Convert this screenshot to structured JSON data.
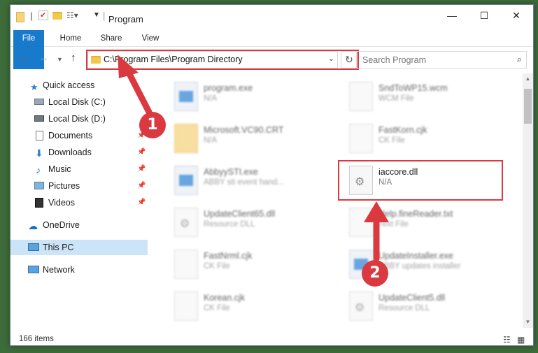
{
  "window": {
    "title": "Program"
  },
  "ribbon": {
    "tabs": [
      "File",
      "Home",
      "Share",
      "View"
    ]
  },
  "address": {
    "path": "C:\\Program Files\\Program Directory"
  },
  "search": {
    "placeholder": "Search Program"
  },
  "nav": {
    "quick_access": "Quick access",
    "items": [
      {
        "label": "Local Disk (C:)",
        "icon": "drive-icon",
        "pinned": false
      },
      {
        "label": "Local Disk (D:)",
        "icon": "drive-icon",
        "pinned": false
      },
      {
        "label": "Documents",
        "icon": "documents-icon",
        "pinned": true
      },
      {
        "label": "Downloads",
        "icon": "downloads-icon",
        "pinned": true
      },
      {
        "label": "Music",
        "icon": "music-icon",
        "pinned": true
      },
      {
        "label": "Pictures",
        "icon": "pictures-icon",
        "pinned": true
      },
      {
        "label": "Videos",
        "icon": "videos-icon",
        "pinned": true
      }
    ],
    "onedrive": "OneDrive",
    "this_pc": "This PC",
    "network": "Network"
  },
  "files": {
    "left": [
      {
        "name": "program.exe",
        "type": "N/A",
        "icon": "app-icon"
      },
      {
        "name": "Microsoft.VC90.CRT",
        "type": "N/A",
        "icon": "folder-icon"
      },
      {
        "name": "AbbyySTI.exe",
        "type": "ABBY sti event hand...",
        "icon": "app-icon"
      },
      {
        "name": "UpdateClient65.dll",
        "type": "Resource DLL",
        "icon": "dll-icon"
      },
      {
        "name": "FastNrml.cjk",
        "type": "CK File",
        "icon": "file-icon"
      },
      {
        "name": "Korean.cjk",
        "type": "CK File",
        "icon": "file-icon"
      }
    ],
    "right": [
      {
        "name": "SndToWP15.wcm",
        "type": "WCM File",
        "icon": "file-icon"
      },
      {
        "name": "FastKorn.cjk",
        "type": "CK File",
        "icon": "file-icon"
      },
      {
        "name": "iaccore.dll",
        "type": "N/A",
        "icon": "dll-icon"
      },
      {
        "name": "Help.fineReader.txt",
        "type": "Text File",
        "icon": "file-icon"
      },
      {
        "name": "UpdateInstaller.exe",
        "type": "ABBY updates installer",
        "icon": "app-icon"
      },
      {
        "name": "UpdateClient5.dll",
        "type": "Resource DLL",
        "icon": "dll-icon"
      }
    ]
  },
  "status": {
    "count": "166 items"
  },
  "annotations": {
    "step1": "1",
    "step2": "2"
  },
  "colors": {
    "accent": "#1979ca",
    "highlight": "#d9393f",
    "selection": "#cce4f7"
  }
}
